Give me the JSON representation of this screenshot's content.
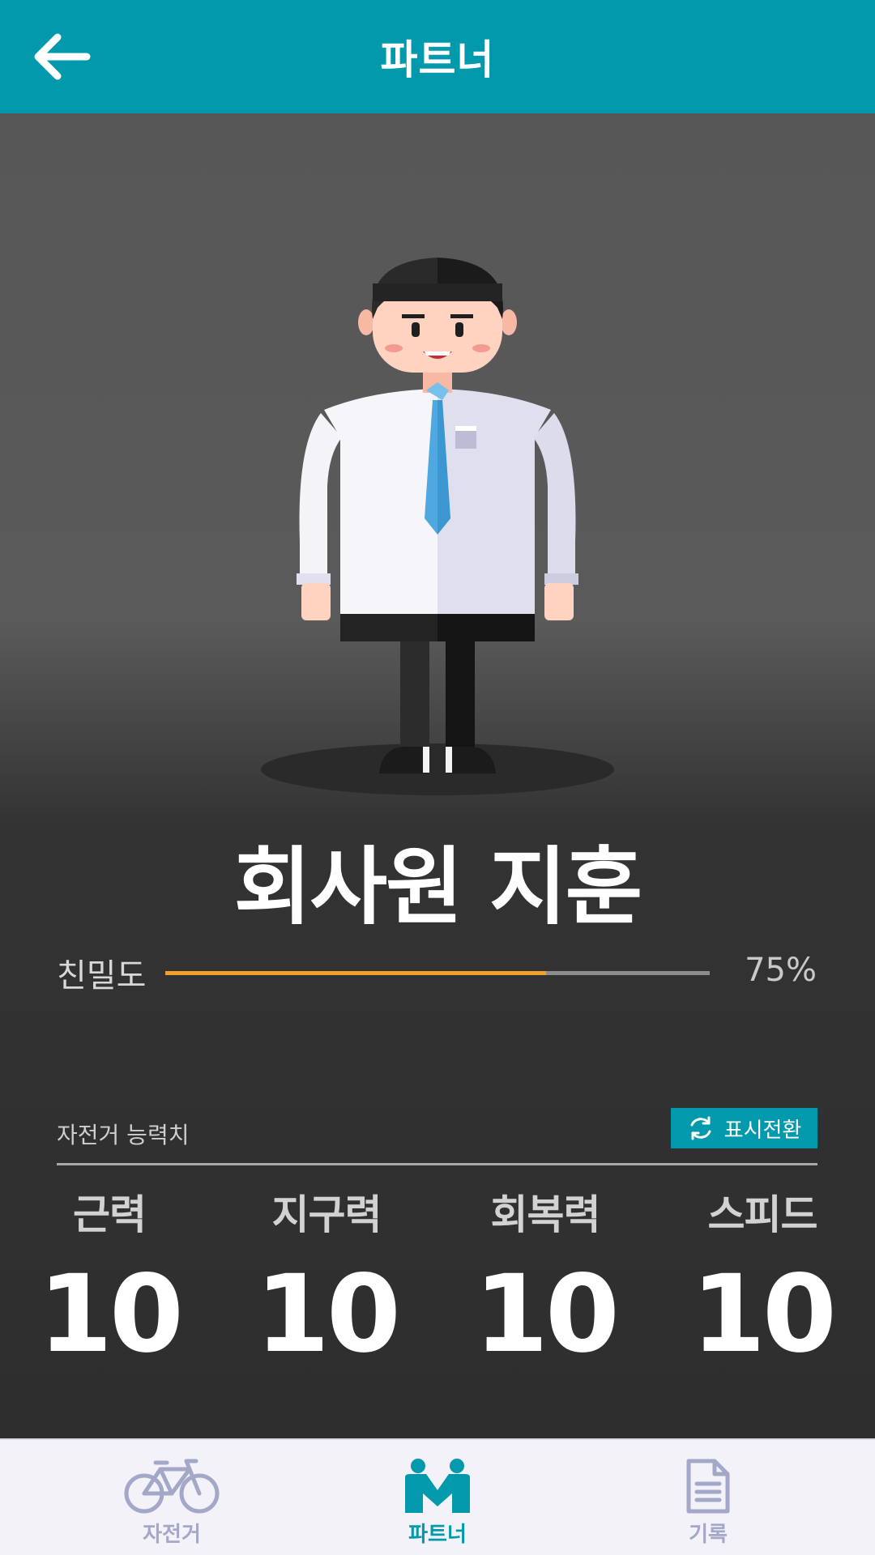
{
  "header": {
    "title": "파트너",
    "back_icon": "arrow-left-icon"
  },
  "partner": {
    "name": "회사원 지훈",
    "affinity": {
      "label": "친밀도",
      "value_text": "75%",
      "progress": 0.7,
      "fill_color": "#f0a12b"
    }
  },
  "abilities": {
    "title": "자전거 능력치",
    "toggle_label": "표시전환",
    "toggle_icon": "refresh-icon",
    "stats": [
      {
        "label": "근력",
        "value": "10"
      },
      {
        "label": "지구력",
        "value": "10"
      },
      {
        "label": "회복력",
        "value": "10"
      },
      {
        "label": "스피드",
        "value": "10"
      }
    ]
  },
  "nav": {
    "items": [
      {
        "label": "자전거",
        "icon": "bicycle-icon",
        "active": false
      },
      {
        "label": "파트너",
        "icon": "partners-icon",
        "active": true
      },
      {
        "label": "기록",
        "icon": "document-icon",
        "active": false
      }
    ]
  },
  "colors": {
    "accent": "#0399ad",
    "inactive": "#a4a8c8"
  }
}
